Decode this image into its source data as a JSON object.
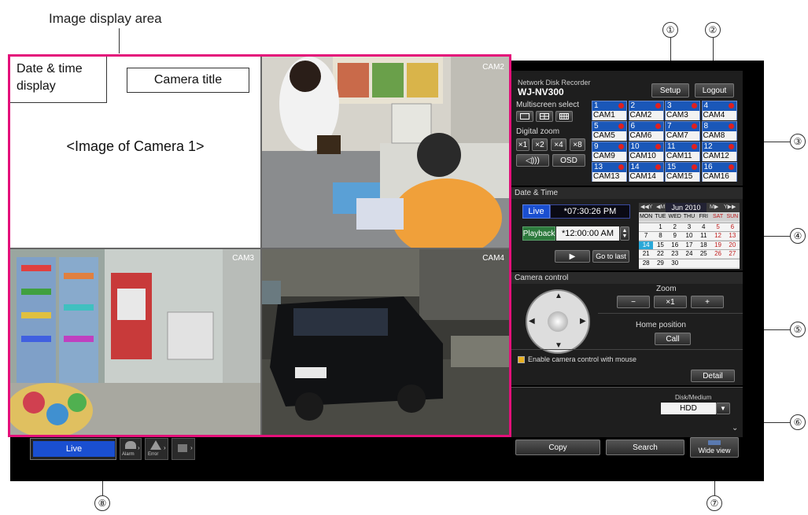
{
  "callouts": {
    "image_display_area": "Image display area",
    "n1": "①",
    "n2": "②",
    "n3": "③",
    "n4": "④",
    "n5": "⑤",
    "n6": "⑥",
    "n7": "⑦",
    "n8": "⑧"
  },
  "tiles": {
    "date_time_label": "Date & time display",
    "camera_title_label": "Camera title",
    "camera1_placeholder": "<Image of Camera 1>",
    "cam2": "CAM2",
    "cam3": "CAM3",
    "cam4": "CAM4"
  },
  "header": {
    "product_line": "Network Disk Recorder",
    "model": "WJ-NV300",
    "setup": "Setup",
    "logout": "Logout"
  },
  "multiscreen": {
    "label": "Multiscreen select",
    "digital_zoom_label": "Digital zoom",
    "zoom_buttons": [
      "×1",
      "×2",
      "×4",
      "×8"
    ],
    "audio": "◁)))",
    "osd": "OSD"
  },
  "cameras": [
    {
      "num": "1",
      "name": "CAM1"
    },
    {
      "num": "2",
      "name": "CAM2"
    },
    {
      "num": "3",
      "name": "CAM3"
    },
    {
      "num": "4",
      "name": "CAM4"
    },
    {
      "num": "5",
      "name": "CAM5"
    },
    {
      "num": "6",
      "name": "CAM6"
    },
    {
      "num": "7",
      "name": "CAM7"
    },
    {
      "num": "8",
      "name": "CAM8"
    },
    {
      "num": "9",
      "name": "CAM9"
    },
    {
      "num": "10",
      "name": "CAM10"
    },
    {
      "num": "11",
      "name": "CAM11"
    },
    {
      "num": "12",
      "name": "CAM12"
    },
    {
      "num": "13",
      "name": "CAM13"
    },
    {
      "num": "14",
      "name": "CAM14"
    },
    {
      "num": "15",
      "name": "CAM15"
    },
    {
      "num": "16",
      "name": "CAM16"
    }
  ],
  "datetime": {
    "header": "Date & Time",
    "live": "Live",
    "live_time": "*07:30:26 PM",
    "playback": "Playback",
    "playback_time": "*12:00:00 AM",
    "play_icon": "▶",
    "go_to_last": "Go to last"
  },
  "calendar": {
    "nav_prev_year": "◀◀Y",
    "nav_prev_month": "◀M",
    "month": "Jun 2010",
    "nav_next_month": "M▶",
    "nav_next_year": "Y▶▶",
    "weekdays": [
      "MON",
      "TUE",
      "WED",
      "THU",
      "FRI",
      "SAT",
      "SUN"
    ],
    "weeks": [
      [
        "",
        "1",
        "2",
        "3",
        "4",
        "5",
        "6"
      ],
      [
        "7",
        "8",
        "9",
        "10",
        "11",
        "12",
        "13"
      ],
      [
        "14",
        "15",
        "16",
        "17",
        "18",
        "19",
        "20"
      ],
      [
        "21",
        "22",
        "23",
        "24",
        "25",
        "26",
        "27"
      ],
      [
        "28",
        "29",
        "30",
        "",
        "",
        "",
        ""
      ]
    ],
    "highlighted_day": "14"
  },
  "camera_control": {
    "header": "Camera control",
    "zoom_label": "Zoom",
    "zoom_out": "−",
    "zoom_x1": "×1",
    "zoom_in": "+",
    "home_position_label": "Home position",
    "call": "Call",
    "mouse_control_label": "Enable camera control with mouse",
    "mouse_control_checked": true,
    "detail": "Detail"
  },
  "disk": {
    "label": "Disk/Medium",
    "selected": "HDD",
    "copy": "Copy",
    "search": "Search",
    "wide_view": "Wide view"
  },
  "bottom_bar": {
    "live": "Live",
    "alarm": "Alarm",
    "error": "Error"
  },
  "colors": {
    "accent_pink": "#e4107a",
    "camera_button_blue": "#1a57b8",
    "live_blue": "#1a4fd0",
    "playback_green": "#2d7a3d",
    "highlight_day": "#2aa8d8"
  }
}
